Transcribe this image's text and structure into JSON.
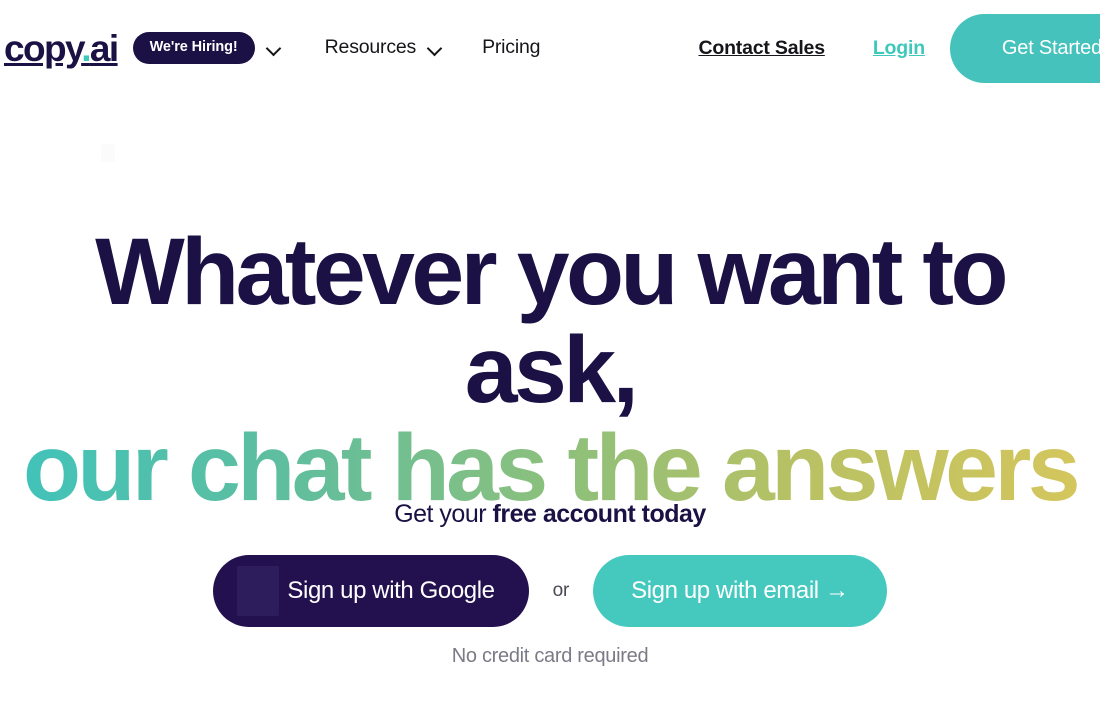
{
  "navbar": {
    "logo": {
      "name": "copy",
      "dot": ".",
      "suffix": "ai"
    },
    "hiring_badge": "We're Hiring!",
    "hiring_chevron": "chevron-down-icon",
    "links": [
      {
        "label": "Resources",
        "has_chevron": true
      },
      {
        "label": "Pricing",
        "has_chevron": false
      }
    ],
    "contact_sales": "Contact Sales",
    "login": "Login",
    "get_started": "Get Started"
  },
  "hero": {
    "headline_line1": "Whatever you want to ask,",
    "headline_line2": "our chat has the answers",
    "subhead_prefix": "Get your ",
    "subhead_bold": "free account today",
    "google_button": "Sign up with Google",
    "or": "or",
    "email_button": "Sign up with email →",
    "no_credit_card": "No credit card required"
  },
  "colors": {
    "navy": "#1B1145",
    "teal": "#3EC8BC",
    "teal_button": "#45C2BB",
    "google_button_bg": "#23104E",
    "gradient_start": "#3FC3BC",
    "gradient_end": "#D6C65C",
    "muted_text": "#7B7B87",
    "page_bg": "#FFFFFF"
  }
}
